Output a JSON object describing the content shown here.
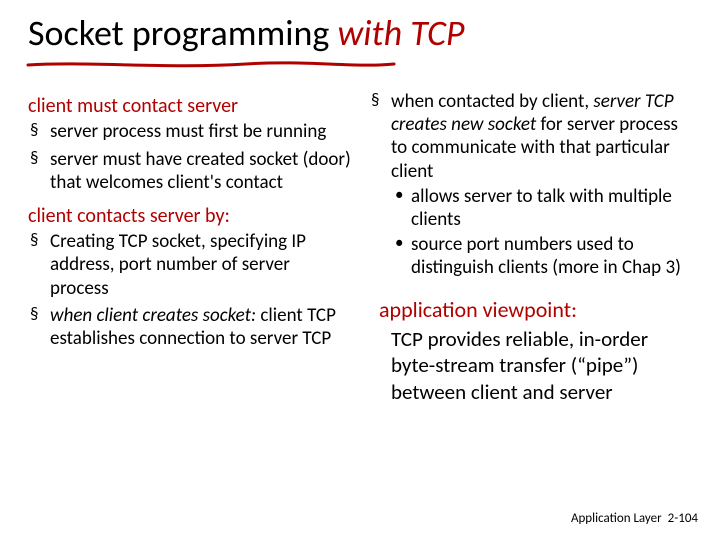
{
  "title": {
    "prefix": "Socket programming ",
    "accent": "with TCP"
  },
  "left": {
    "lede1": "client must contact server",
    "items1": [
      "server process must first be running",
      "server must have created socket (door) that welcomes client's contact"
    ],
    "lede2": "client contacts server by:",
    "items2_plain": [
      "Creating TCP socket, specifying IP address, port number of server process"
    ],
    "items2_em_lead": "when client creates socket:",
    "items2_em_rest": " client TCP establishes connection to server TCP"
  },
  "right": {
    "item_lead": "when contacted by client, ",
    "item_em": "server TCP creates new socket",
    "item_rest": " for server process to communicate with that particular client",
    "sub": [
      "allows server to talk with multiple clients",
      "source port numbers used to distinguish clients (more in Chap 3)"
    ],
    "view_head": "application viewpoint:",
    "view_body": "TCP provides reliable, in-order byte-stream transfer (“pipe”) between client and server"
  },
  "footer": {
    "label": "Application Layer",
    "page": "2-104"
  }
}
